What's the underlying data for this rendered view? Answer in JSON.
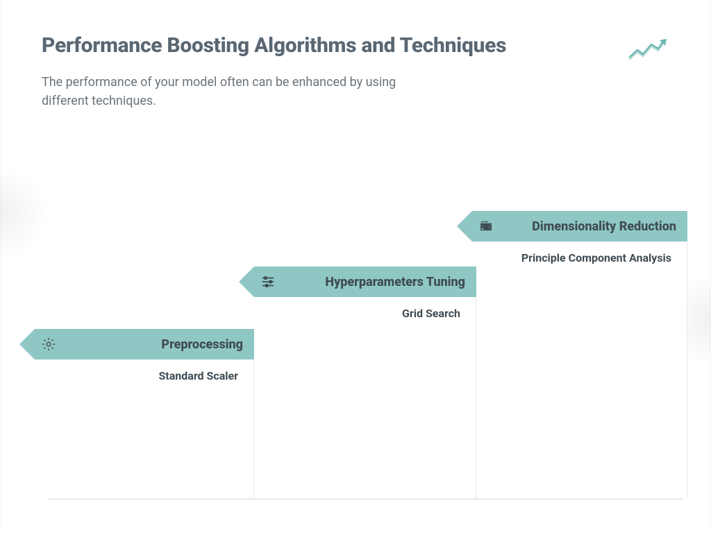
{
  "title": "Performance Boosting Algorithms and Techniques",
  "subtitle": "The performance of your model often can be enhanced by using different techniques.",
  "steps": [
    {
      "label": "Preprocessing",
      "item": "Standard Scaler",
      "icon": "gear"
    },
    {
      "label": "Hyperparameters Tuning",
      "item": "Grid Search",
      "icon": "sliders"
    },
    {
      "label": "Dimensionality Reduction",
      "item": "Principle Component Analysis",
      "icon": "grid-reduce"
    }
  ],
  "colors": {
    "accent": "#8fc7c4",
    "text_heading": "#5a6773",
    "text_body": "#6a737a",
    "text_label": "#3f4b52"
  }
}
